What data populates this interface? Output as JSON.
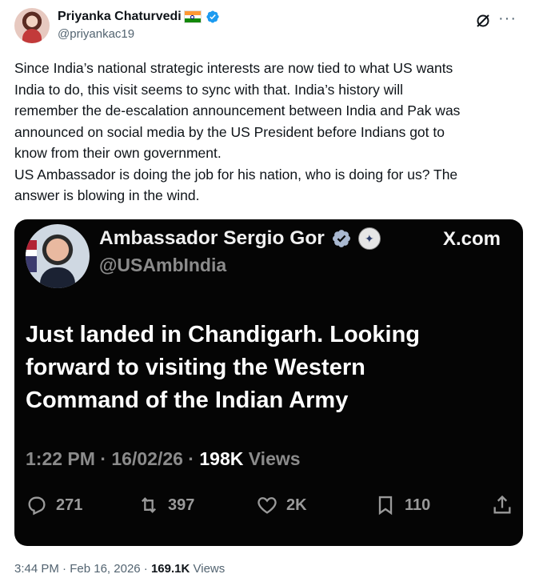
{
  "author": {
    "name": "Priyanka Chaturvedi",
    "handle": "@priyankac19",
    "flag_icon": "india-flag-icon",
    "verified_color": "#1d9bf0"
  },
  "tweet": {
    "text": "Since India’s national strategic interests are now tied to what US wants\nIndia to do, this visit seems to sync with that. India’s history will\nremember the de-escalation announcement between India and Pak was\nannounced on social media by the US President before Indians got to\nknow from their own government.\nUS Ambassador is doing the job for his nation, who is doing for us? The\nanswer is blowing in the wind."
  },
  "embedded_post": {
    "name": "Ambassador Sergio Gor",
    "handle": "@USAmbIndia",
    "source": "X.com",
    "text": "Just landed in Chandigarh. Looking\nforward to visiting the Western\nCommand of the Indian Army",
    "time": "1:22 PM",
    "date": "16/02/26",
    "views_count": "198K",
    "views_label": "Views",
    "replies": "271",
    "reposts": "397",
    "likes": "2K",
    "bookmarks": "110"
  },
  "footer": {
    "time": "3:44 PM",
    "date": "Feb 16, 2026",
    "views_count": "169.1K",
    "views_label": "Views"
  }
}
